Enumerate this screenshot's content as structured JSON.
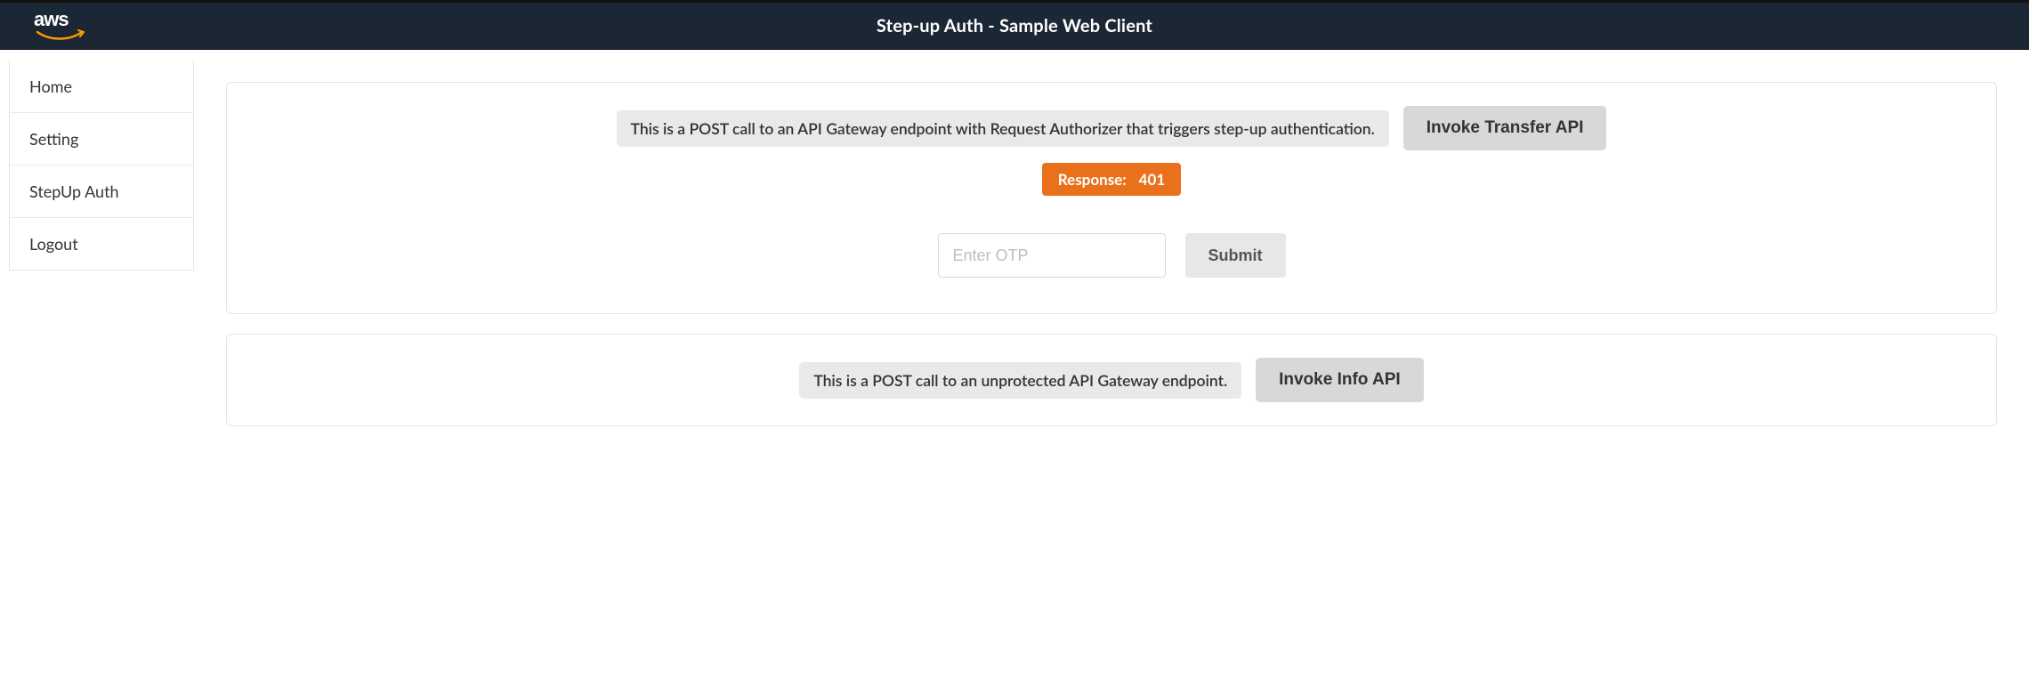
{
  "header": {
    "title": "Step-up Auth - Sample Web Client",
    "logo_text": "aws"
  },
  "sidebar": {
    "items": [
      {
        "label": "Home"
      },
      {
        "label": "Setting"
      },
      {
        "label": "StepUp Auth"
      },
      {
        "label": "Logout"
      }
    ]
  },
  "transfer_card": {
    "description": "This is a POST call to an API Gateway endpoint with Request Authorizer that triggers step-up authentication.",
    "button_label": "Invoke Transfer API",
    "response_label": "Response:",
    "response_code": "401",
    "otp_placeholder": "Enter OTP",
    "otp_value": "",
    "submit_label": "Submit"
  },
  "info_card": {
    "description": "This is a POST call to an unprotected API Gateway endpoint.",
    "button_label": "Invoke Info API"
  },
  "colors": {
    "header_bg": "#1b2735",
    "accent_orange": "#e9711c",
    "aws_orange": "#ff9900"
  }
}
